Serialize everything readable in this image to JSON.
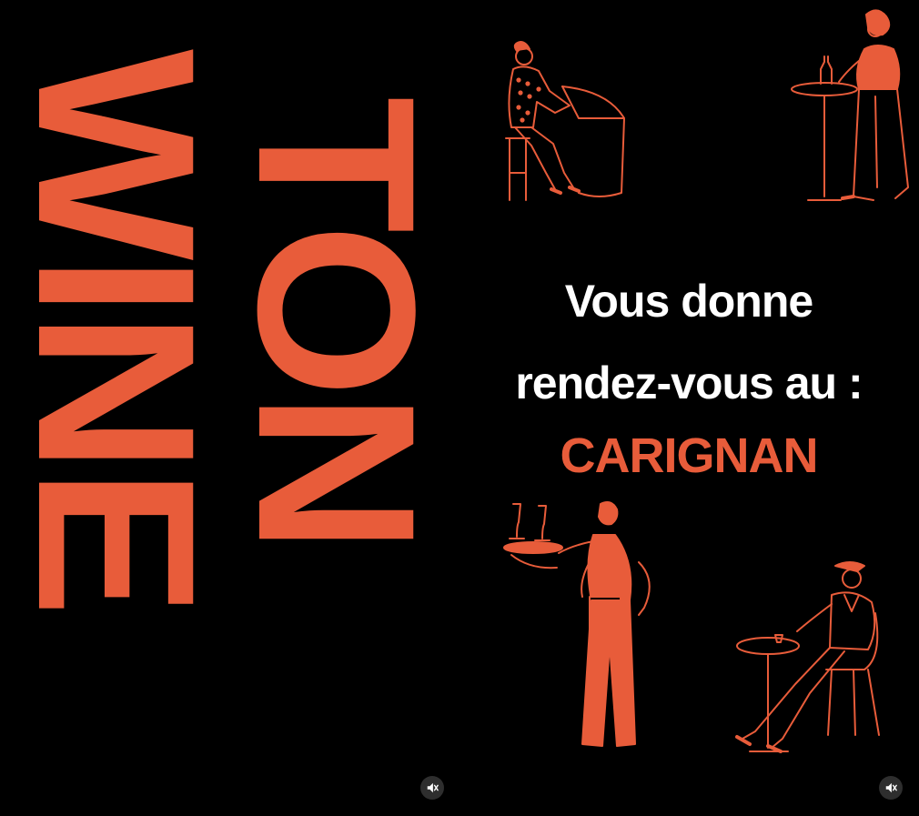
{
  "logo": {
    "word1": "WINE",
    "word2": "TON"
  },
  "tagline": {
    "line1": "Vous donne",
    "line2": "rendez-vous au :"
  },
  "venue": "CARIGNAN",
  "colors": {
    "background": "#000000",
    "accent": "#e85c3a",
    "text": "#ffffff",
    "control_bg": "#2e2e2e"
  },
  "controls": {
    "mute_icon_left": "speaker-muted-icon",
    "mute_icon_right": "speaker-muted-icon"
  }
}
